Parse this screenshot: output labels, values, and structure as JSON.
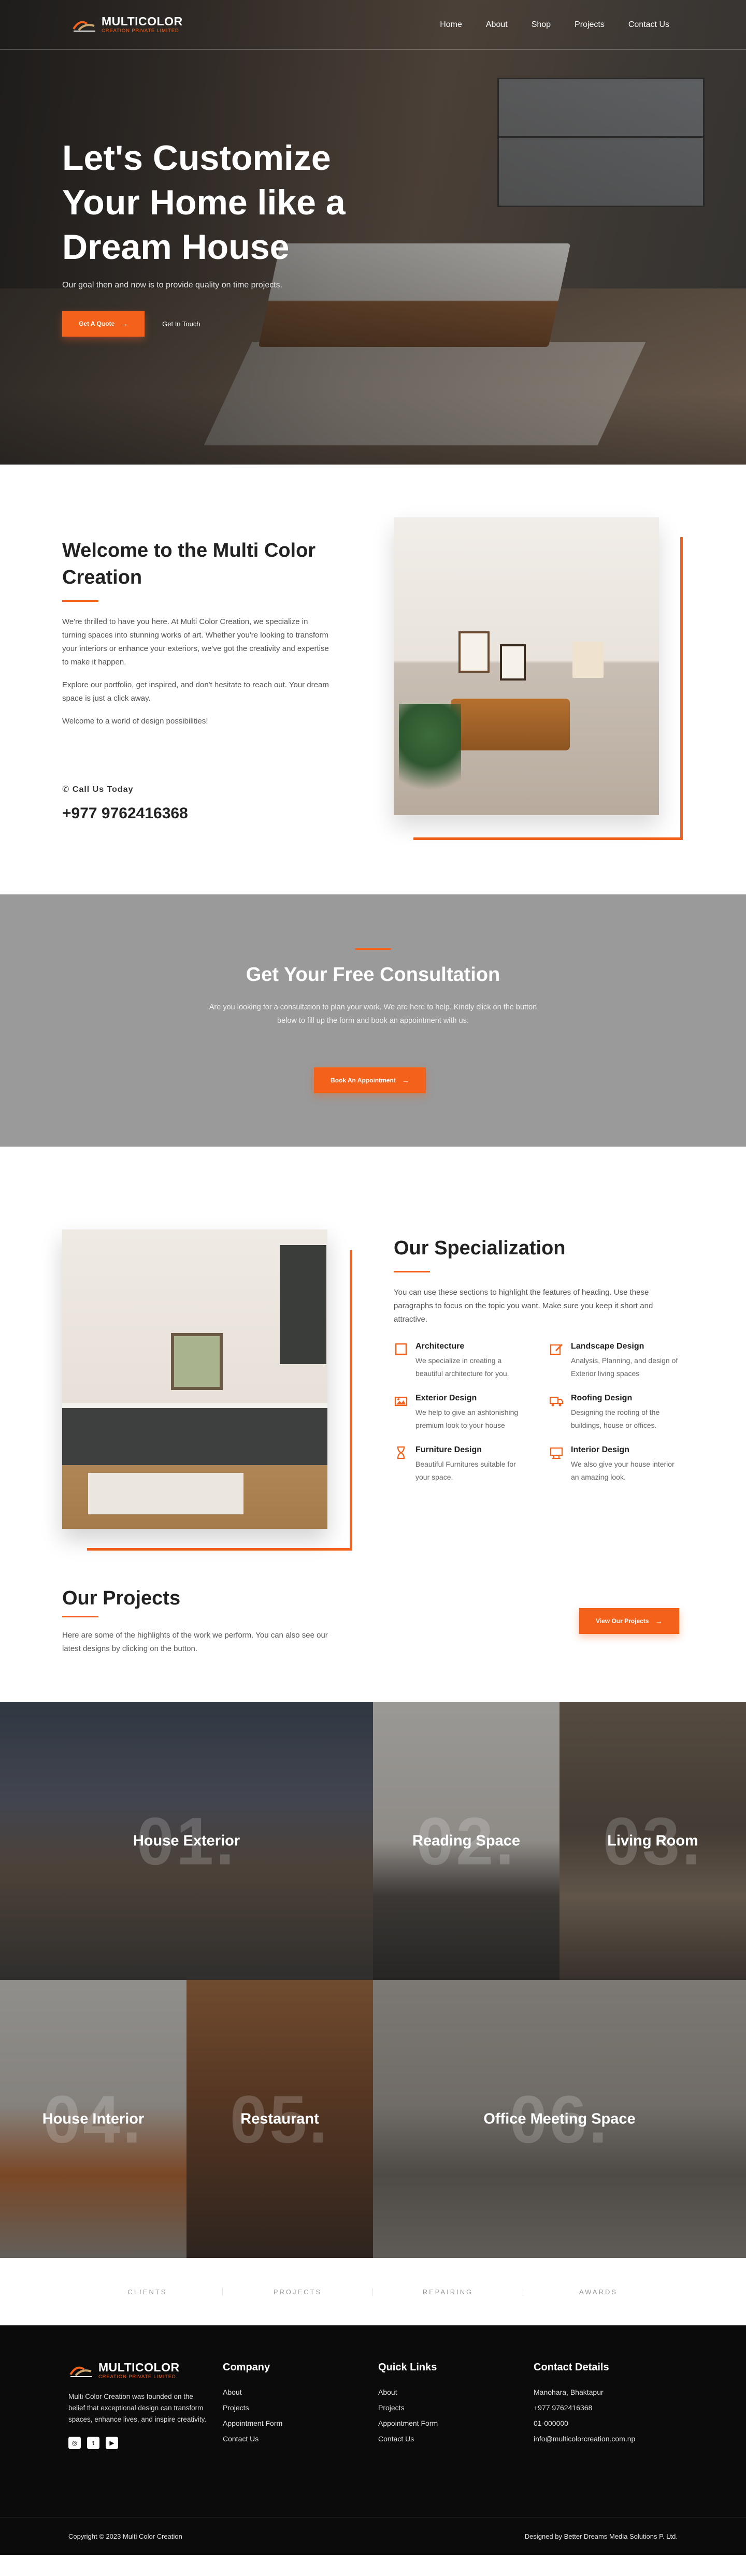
{
  "brand": {
    "name": "MULTICOLOR",
    "tagline": "CREATION PRIVATE LIMITED"
  },
  "nav": {
    "items": [
      "Home",
      "About",
      "Shop",
      "Projects",
      "Contact Us"
    ]
  },
  "hero": {
    "title": "Let's Customize Your Home like a Dream House",
    "subtitle": "Our goal then and now is to provide quality on time projects.",
    "primary_button": "Get A Quote",
    "secondary_button": "Get In Touch"
  },
  "welcome": {
    "title": "Welcome to the Multi Color Creation",
    "paragraphs": [
      "We're thrilled to have you here. At Multi Color Creation, we specialize in turning spaces into stunning works of art. Whether you're looking to transform your interiors or enhance your exteriors, we've got the creativity and expertise to make it happen.",
      "Explore our portfolio, get inspired, and don't hesitate to reach out. Your dream space is just a click away.",
      "Welcome to a world of design possibilities!"
    ],
    "call_label": "Call Us Today",
    "phone": "+977 9762416368"
  },
  "consultation": {
    "title": "Get Your Free Consultation",
    "text": "Are you looking for a consultation to plan your work. We are here to help. Kindly click on the button below to fill up the form and book an appointment with us.",
    "button": "Book An Appointment"
  },
  "specialization": {
    "title": "Our Specialization",
    "intro": "You can use these sections to highlight the features of heading. Use these paragraphs to focus on the topic you want. Make sure you keep it short and attractive.",
    "items": [
      {
        "title": "Architecture",
        "desc": "We specialize in creating a beautiful architecture for you.",
        "icon": "square-icon"
      },
      {
        "title": "Landscape Design",
        "desc": "Analysis, Planning, and design of Exterior living spaces",
        "icon": "pencil-square-icon"
      },
      {
        "title": "Exterior Design",
        "desc": "We help to give an ashtonishing premium look to your house",
        "icon": "photo-icon"
      },
      {
        "title": "Roofing Design",
        "desc": "Designing the roofing of the buildings, house or offices.",
        "icon": "truck-icon"
      },
      {
        "title": "Furniture Design",
        "desc": "Beautiful Furnitures suitable for your space.",
        "icon": "hourglass-icon"
      },
      {
        "title": "Interior Design",
        "desc": "We also give your house interior an amazing look.",
        "icon": "desk-icon"
      }
    ]
  },
  "projects": {
    "title": "Our Projects",
    "intro": "Here are some of the highlights of the work we perform. You can also see our latest designs by clicking on the button.",
    "button": "View Our Projects",
    "tiles": [
      {
        "num": "01.",
        "title": "House Exterior"
      },
      {
        "num": "02.",
        "title": "Reading Space"
      },
      {
        "num": "03.",
        "title": "Living Room"
      },
      {
        "num": "04.",
        "title": "House Interior"
      },
      {
        "num": "05.",
        "title": "Restaurant"
      },
      {
        "num": "06.",
        "title": "Office Meeting Space"
      }
    ]
  },
  "categories": [
    "CLIENTS",
    "PROJECTS",
    "REPAIRING",
    "AWARDS"
  ],
  "footer": {
    "about": "Multi Color Creation was founded on the belief that exceptional design can transform spaces, enhance lives, and inspire creativity.",
    "company": {
      "title": "Company",
      "links": [
        "About",
        "Projects",
        "Appointment Form",
        "Contact Us"
      ]
    },
    "quick": {
      "title": "Quick Links",
      "links": [
        "About",
        "Projects",
        "Appointment Form",
        "Contact Us"
      ]
    },
    "contact": {
      "title": "Contact Details",
      "lines": [
        "Manohara, Bhaktapur",
        "+977 9762416368",
        "01-000000",
        "info@multicolorcreation.com.np"
      ]
    },
    "copyright": "Copyright © 2023 Multi Color Creation",
    "credit": "Designed by Better Dreams Media Solutions P. Ltd."
  },
  "colors": {
    "accent": "#f4611b",
    "consult_bg": "#9a9a9a",
    "footer_bg": "#0b0b0b"
  }
}
